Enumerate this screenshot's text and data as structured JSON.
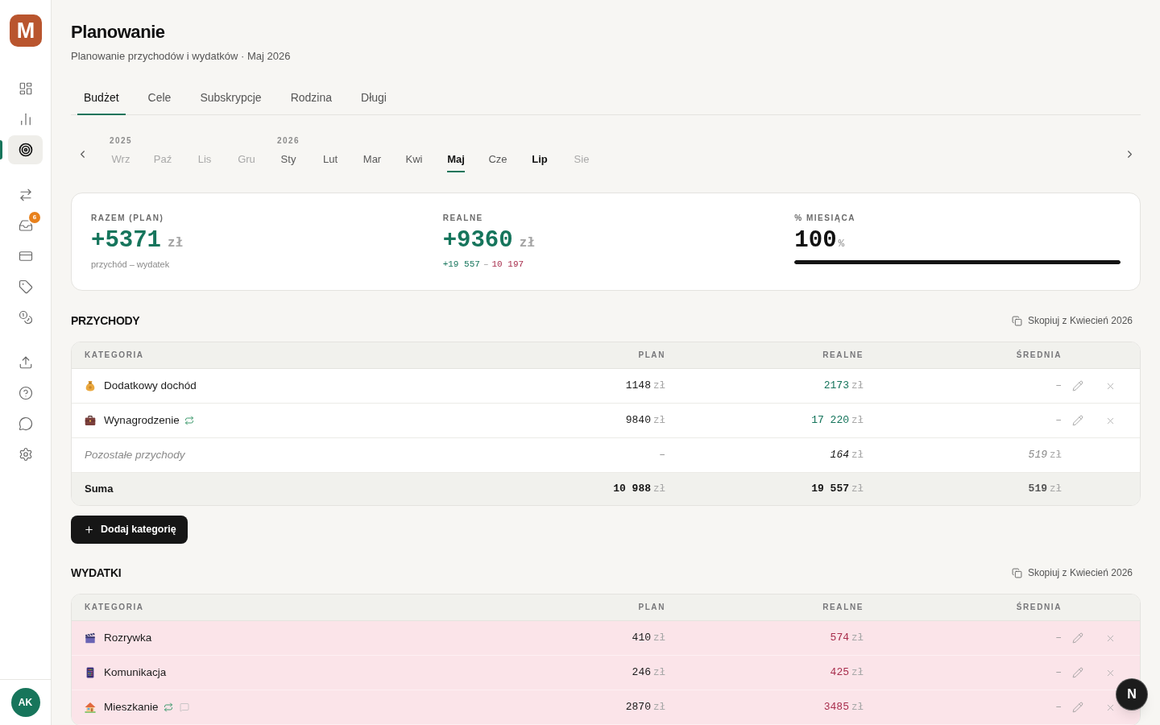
{
  "sidebar": {
    "logo": "M",
    "groups": [
      {
        "items": [
          {
            "selected": false
          },
          {
            "selected": false
          },
          {
            "selected": true
          }
        ]
      },
      {
        "items": [
          {
            "selected": false
          },
          {
            "selected": false,
            "badge": "6"
          },
          {
            "selected": false
          },
          {
            "selected": false
          },
          {
            "selected": false
          }
        ]
      },
      {
        "items": [
          {
            "selected": false
          },
          {
            "selected": false
          },
          {
            "selected": false
          },
          {
            "selected": false
          }
        ]
      }
    ],
    "avatar": "AK"
  },
  "header": {
    "title": "Planowanie",
    "subtitle": "Planowanie przychodów i wydatków · Maj 2026"
  },
  "tabs": [
    {
      "label": "Budżet",
      "selected": true
    },
    {
      "label": "Cele",
      "selected": false
    },
    {
      "label": "Subskrypcje",
      "selected": false
    },
    {
      "label": "Rodzina",
      "selected": false
    },
    {
      "label": "Długi",
      "selected": false
    }
  ],
  "month_picker": {
    "years": [
      {
        "label": "2025",
        "months": [
          {
            "label": "Wrz",
            "selected": false,
            "muted": true,
            "emphasized": false
          },
          {
            "label": "Paź",
            "selected": false,
            "muted": true,
            "emphasized": false
          },
          {
            "label": "Lis",
            "selected": false,
            "muted": true,
            "emphasized": false
          },
          {
            "label": "Gru",
            "selected": false,
            "muted": true,
            "emphasized": false
          }
        ]
      },
      {
        "label": "2026",
        "months": [
          {
            "label": "Sty",
            "selected": false,
            "muted": false,
            "emphasized": false
          },
          {
            "label": "Lut",
            "selected": false,
            "muted": false,
            "emphasized": false
          },
          {
            "label": "Mar",
            "selected": false,
            "muted": false,
            "emphasized": false
          },
          {
            "label": "Kwi",
            "selected": false,
            "muted": false,
            "emphasized": false
          },
          {
            "label": "Maj",
            "selected": true,
            "muted": false,
            "emphasized": true
          },
          {
            "label": "Cze",
            "selected": false,
            "muted": false,
            "emphasized": false
          },
          {
            "label": "Lip",
            "selected": false,
            "muted": false,
            "emphasized": true
          },
          {
            "label": "Sie",
            "selected": false,
            "muted": true,
            "emphasized": false
          }
        ]
      }
    ]
  },
  "summary": [
    {
      "kind": "plain",
      "label": "RAZEM (PLAN)",
      "value": "+5371",
      "unit": "zł",
      "positive": true,
      "note": "przychód – wydatek"
    },
    {
      "kind": "breakdown",
      "label": "REALNE",
      "value": "+9360",
      "unit": "zł",
      "positive": true,
      "income": "+19 557",
      "separator": "–",
      "expense": "10 197"
    },
    {
      "kind": "progress",
      "label": "% MIESIĄCA",
      "value": "100",
      "unit": "%",
      "positive": false,
      "level": 1
    }
  ],
  "sections": [
    {
      "kind": "income",
      "title": "PRZYCHODY",
      "copy_button": "Skopiuj z Kwiecień 2026",
      "columns": [
        "KATEGORIA",
        "PLAN",
        "REALNE",
        "ŚREDNIA"
      ],
      "rows": [
        {
          "kind": "category",
          "name": "Dodatkowy dochód",
          "recurring": false,
          "has_note": false,
          "over_plan": true,
          "plan": {
            "value": "1148",
            "unit": "zł"
          },
          "actual": {
            "value": "2173",
            "unit": "zł"
          },
          "average": {
            "value": "–"
          }
        },
        {
          "kind": "category",
          "name": "Wynagrodzenie",
          "recurring": true,
          "has_note": false,
          "over_plan": true,
          "plan": {
            "value": "9840",
            "unit": "zł"
          },
          "actual": {
            "value": "17 220",
            "unit": "zł"
          },
          "average": {
            "value": "–"
          }
        },
        {
          "kind": "remainder",
          "name": "Pozostałe przychody",
          "recurring": false,
          "has_note": false,
          "over_plan": false,
          "plan": {
            "value": "–"
          },
          "actual": {
            "value": "164",
            "unit": "zł"
          },
          "average": {
            "value": "519",
            "unit": "zł"
          }
        }
      ],
      "total": {
        "label": "Suma",
        "plan": {
          "value": "10 988",
          "unit": "zł"
        },
        "actual": {
          "value": "19 557",
          "unit": "zł"
        },
        "average": {
          "value": "519",
          "unit": "zł"
        }
      },
      "add_button": "Dodaj kategorię"
    },
    {
      "kind": "expense",
      "title": "WYDATKI",
      "copy_button": "Skopiuj z Kwiecień 2026",
      "columns": [
        "KATEGORIA",
        "PLAN",
        "REALNE",
        "ŚREDNIA"
      ],
      "rows": [
        {
          "kind": "category",
          "name": "Rozrywka",
          "recurring": false,
          "has_note": false,
          "over_plan": true,
          "plan": {
            "value": "410",
            "unit": "zł"
          },
          "actual": {
            "value": "574",
            "unit": "zł"
          },
          "average": {
            "value": "–"
          }
        },
        {
          "kind": "category",
          "name": "Komunikacja",
          "recurring": false,
          "has_note": false,
          "over_plan": true,
          "plan": {
            "value": "246",
            "unit": "zł"
          },
          "actual": {
            "value": "425",
            "unit": "zł"
          },
          "average": {
            "value": "–"
          }
        },
        {
          "kind": "category",
          "name": "Mieszkanie",
          "recurring": true,
          "has_note": true,
          "over_plan": true,
          "plan": {
            "value": "2870",
            "unit": "zł"
          },
          "actual": {
            "value": "3485",
            "unit": "zł"
          },
          "average": {
            "value": "–"
          }
        }
      ]
    }
  ],
  "floating_button": {
    "label": "N"
  }
}
